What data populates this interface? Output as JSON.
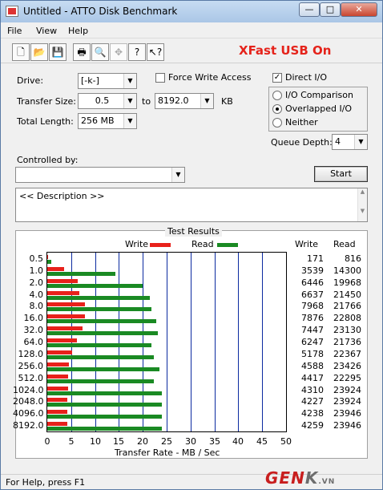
{
  "window": {
    "title": "Untitled - ATTO Disk Benchmark",
    "min_glyph": "—",
    "max_glyph": "□",
    "close_glyph": "✕"
  },
  "menu": [
    "File",
    "View",
    "Help"
  ],
  "toolbar_icons": [
    "new-file-icon",
    "open-folder-icon",
    "save-icon",
    "print-icon",
    "print-preview-icon",
    "move-icon",
    "help-icon",
    "context-help-icon"
  ],
  "toolbar_glyphs": [
    "🗋",
    "📂",
    "💾",
    "🖶",
    "🔍",
    "✥",
    "?",
    "↖?"
  ],
  "banner": "XFast USB On",
  "settings": {
    "drive_label": "Drive:",
    "drive_value": "[-k-]",
    "transfer_label": "Transfer Size:",
    "transfer_from": "0.5",
    "transfer_to_word": "to",
    "transfer_to": "8192.0",
    "transfer_unit": "KB",
    "length_label": "Total Length:",
    "length_value": "256 MB",
    "force_write": "Force Write Access",
    "force_write_checked": false,
    "direct_io": "Direct I/O",
    "direct_io_checked": true,
    "io_comparison": "I/O Comparison",
    "overlapped_io": "Overlapped I/O",
    "neither": "Neither",
    "selected_mode": "Overlapped I/O",
    "queue_label": "Queue Depth:",
    "queue_value": "4",
    "controlled_label": "Controlled by:",
    "controlled_value": "",
    "start_label": "Start",
    "description": "<< Description >>"
  },
  "results": {
    "title": "Test Results",
    "write_label": "Write",
    "read_label": "Read",
    "write_col": "Write",
    "read_col": "Read"
  },
  "chart_data": {
    "type": "bar",
    "orientation": "horizontal",
    "title": "Test Results",
    "xlabel": "Transfer Rate - MB / Sec",
    "xlim": [
      0,
      50
    ],
    "xticks": [
      "0",
      "5",
      "10",
      "15",
      "20",
      "25",
      "30",
      "35",
      "40",
      "45",
      "50"
    ],
    "categories": [
      "0.5",
      "1.0",
      "2.0",
      "4.0",
      "8.0",
      "16.0",
      "32.0",
      "64.0",
      "128.0",
      "256.0",
      "512.0",
      "1024.0",
      "2048.0",
      "4096.0",
      "8192.0"
    ],
    "series": [
      {
        "name": "Write",
        "color": "#e8211b",
        "values": [
          171,
          3539,
          6446,
          6637,
          7968,
          7876,
          7447,
          6247,
          5178,
          4588,
          4417,
          4310,
          4227,
          4238,
          4259
        ]
      },
      {
        "name": "Read",
        "color": "#1a8a23",
        "values": [
          816,
          14300,
          19968,
          21450,
          21766,
          22808,
          23130,
          21736,
          22367,
          23426,
          22295,
          23924,
          23924,
          23946,
          23946
        ]
      }
    ],
    "value_units": "KB/s",
    "grid": true
  },
  "status": "For Help, press F1",
  "watermark": {
    "main": "GEN",
    "k": "K",
    "suffix": ".VN"
  }
}
